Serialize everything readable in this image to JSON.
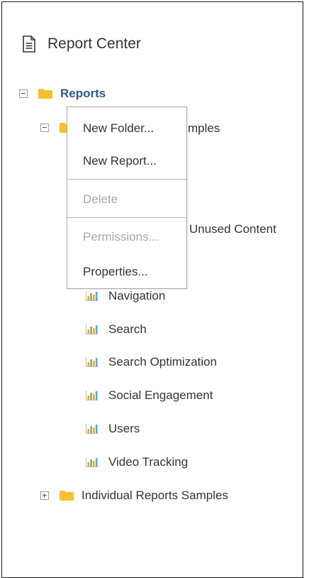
{
  "header": {
    "title": "Report Center",
    "icon": "document-icon"
  },
  "tree": {
    "root": {
      "label": "Reports",
      "expanded": true
    },
    "folder1": {
      "label": "Individual Reports Samples",
      "expanded": true,
      "partial_label": "mples"
    },
    "hidden_item_suffix": "Unused Content",
    "reports": [
      "Navigation",
      "Search",
      "Search Optimization",
      "Social Engagement",
      "Users",
      "Video Tracking"
    ],
    "folder2": {
      "label": "Individual Reports Samples",
      "expanded": false
    }
  },
  "context_menu": {
    "items": [
      {
        "label": "New Folder...",
        "enabled": true
      },
      {
        "label": "New Report...",
        "enabled": true
      },
      {
        "label": "Delete",
        "enabled": false
      },
      {
        "label": "Permissions...",
        "enabled": false
      },
      {
        "label": "Properties...",
        "enabled": true
      }
    ]
  },
  "colors": {
    "folder": "#f5c02c",
    "root_label": "#2f5a8a",
    "disabled": "#a8a8a8"
  }
}
